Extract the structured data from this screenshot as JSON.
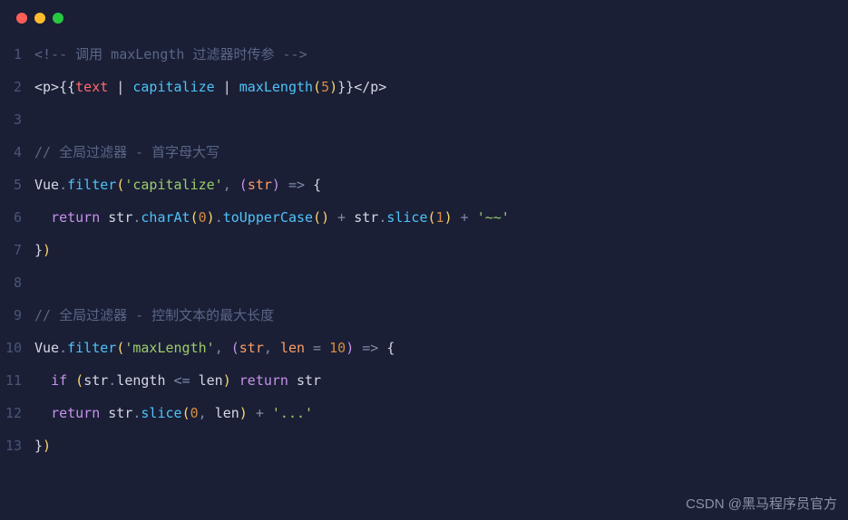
{
  "window": {
    "controls": [
      "close",
      "minimize",
      "maximize"
    ]
  },
  "code": {
    "lines": [
      {
        "num": "1",
        "tokens": [
          {
            "cls": "comment",
            "t": "<!-- 调用 maxLength 过滤器时传参 -->"
          }
        ]
      },
      {
        "num": "2",
        "tokens": [
          {
            "cls": "tag",
            "t": "<p>"
          },
          {
            "cls": "brace",
            "t": "{{"
          },
          {
            "cls": "attr-text",
            "t": "text"
          },
          {
            "cls": "pipe",
            "t": " | "
          },
          {
            "cls": "func",
            "t": "capitalize"
          },
          {
            "cls": "pipe",
            "t": " | "
          },
          {
            "cls": "func",
            "t": "maxLength"
          },
          {
            "cls": "paren",
            "t": "("
          },
          {
            "cls": "number",
            "t": "5"
          },
          {
            "cls": "paren",
            "t": ")"
          },
          {
            "cls": "brace",
            "t": "}}"
          },
          {
            "cls": "tag",
            "t": "</p>"
          }
        ]
      },
      {
        "num": "3",
        "tokens": []
      },
      {
        "num": "4",
        "tokens": [
          {
            "cls": "comment",
            "t": "// 全局过滤器 - 首字母大写"
          }
        ]
      },
      {
        "num": "5",
        "tokens": [
          {
            "cls": "var-name",
            "t": "Vue"
          },
          {
            "cls": "dot-sep",
            "t": "."
          },
          {
            "cls": "prop",
            "t": "filter"
          },
          {
            "cls": "paren",
            "t": "("
          },
          {
            "cls": "string",
            "t": "'capitalize'"
          },
          {
            "cls": "op",
            "t": ", "
          },
          {
            "cls": "paren2",
            "t": "("
          },
          {
            "cls": "param",
            "t": "str"
          },
          {
            "cls": "paren2",
            "t": ")"
          },
          {
            "cls": "op",
            "t": " => "
          },
          {
            "cls": "brace",
            "t": "{"
          }
        ]
      },
      {
        "num": "6",
        "tokens": [
          {
            "cls": "",
            "t": "  "
          },
          {
            "cls": "keyword",
            "t": "return"
          },
          {
            "cls": "",
            "t": " "
          },
          {
            "cls": "var-name",
            "t": "str"
          },
          {
            "cls": "dot-sep",
            "t": "."
          },
          {
            "cls": "prop",
            "t": "charAt"
          },
          {
            "cls": "paren",
            "t": "("
          },
          {
            "cls": "number",
            "t": "0"
          },
          {
            "cls": "paren",
            "t": ")"
          },
          {
            "cls": "dot-sep",
            "t": "."
          },
          {
            "cls": "prop",
            "t": "toUpperCase"
          },
          {
            "cls": "paren",
            "t": "()"
          },
          {
            "cls": "op",
            "t": " + "
          },
          {
            "cls": "var-name",
            "t": "str"
          },
          {
            "cls": "dot-sep",
            "t": "."
          },
          {
            "cls": "prop",
            "t": "slice"
          },
          {
            "cls": "paren",
            "t": "("
          },
          {
            "cls": "number",
            "t": "1"
          },
          {
            "cls": "paren",
            "t": ")"
          },
          {
            "cls": "op",
            "t": " + "
          },
          {
            "cls": "string",
            "t": "'~~'"
          }
        ]
      },
      {
        "num": "7",
        "tokens": [
          {
            "cls": "brace",
            "t": "}"
          },
          {
            "cls": "paren",
            "t": ")"
          }
        ]
      },
      {
        "num": "8",
        "tokens": []
      },
      {
        "num": "9",
        "tokens": [
          {
            "cls": "comment",
            "t": "// 全局过滤器 - 控制文本的最大长度"
          }
        ]
      },
      {
        "num": "10",
        "tokens": [
          {
            "cls": "var-name",
            "t": "Vue"
          },
          {
            "cls": "dot-sep",
            "t": "."
          },
          {
            "cls": "prop",
            "t": "filter"
          },
          {
            "cls": "paren",
            "t": "("
          },
          {
            "cls": "string",
            "t": "'maxLength'"
          },
          {
            "cls": "op",
            "t": ", "
          },
          {
            "cls": "paren2",
            "t": "("
          },
          {
            "cls": "param",
            "t": "str"
          },
          {
            "cls": "op",
            "t": ", "
          },
          {
            "cls": "param",
            "t": "len"
          },
          {
            "cls": "eq",
            "t": " = "
          },
          {
            "cls": "number",
            "t": "10"
          },
          {
            "cls": "paren2",
            "t": ")"
          },
          {
            "cls": "op",
            "t": " => "
          },
          {
            "cls": "brace",
            "t": "{"
          }
        ]
      },
      {
        "num": "11",
        "tokens": [
          {
            "cls": "",
            "t": "  "
          },
          {
            "cls": "keyword",
            "t": "if"
          },
          {
            "cls": "",
            "t": " "
          },
          {
            "cls": "paren",
            "t": "("
          },
          {
            "cls": "var-name",
            "t": "str"
          },
          {
            "cls": "dot-sep",
            "t": "."
          },
          {
            "cls": "var-name",
            "t": "length"
          },
          {
            "cls": "op",
            "t": " <= "
          },
          {
            "cls": "var-name",
            "t": "len"
          },
          {
            "cls": "paren",
            "t": ")"
          },
          {
            "cls": "",
            "t": " "
          },
          {
            "cls": "keyword",
            "t": "return"
          },
          {
            "cls": "",
            "t": " "
          },
          {
            "cls": "var-name",
            "t": "str"
          }
        ]
      },
      {
        "num": "12",
        "tokens": [
          {
            "cls": "",
            "t": "  "
          },
          {
            "cls": "keyword",
            "t": "return"
          },
          {
            "cls": "",
            "t": " "
          },
          {
            "cls": "var-name",
            "t": "str"
          },
          {
            "cls": "dot-sep",
            "t": "."
          },
          {
            "cls": "prop",
            "t": "slice"
          },
          {
            "cls": "paren",
            "t": "("
          },
          {
            "cls": "number",
            "t": "0"
          },
          {
            "cls": "op",
            "t": ", "
          },
          {
            "cls": "var-name",
            "t": "len"
          },
          {
            "cls": "paren",
            "t": ")"
          },
          {
            "cls": "op",
            "t": " + "
          },
          {
            "cls": "string",
            "t": "'...'"
          }
        ]
      },
      {
        "num": "13",
        "tokens": [
          {
            "cls": "brace",
            "t": "}"
          },
          {
            "cls": "paren",
            "t": ")"
          }
        ]
      }
    ]
  },
  "watermark": "CSDN @黑马程序员官方"
}
